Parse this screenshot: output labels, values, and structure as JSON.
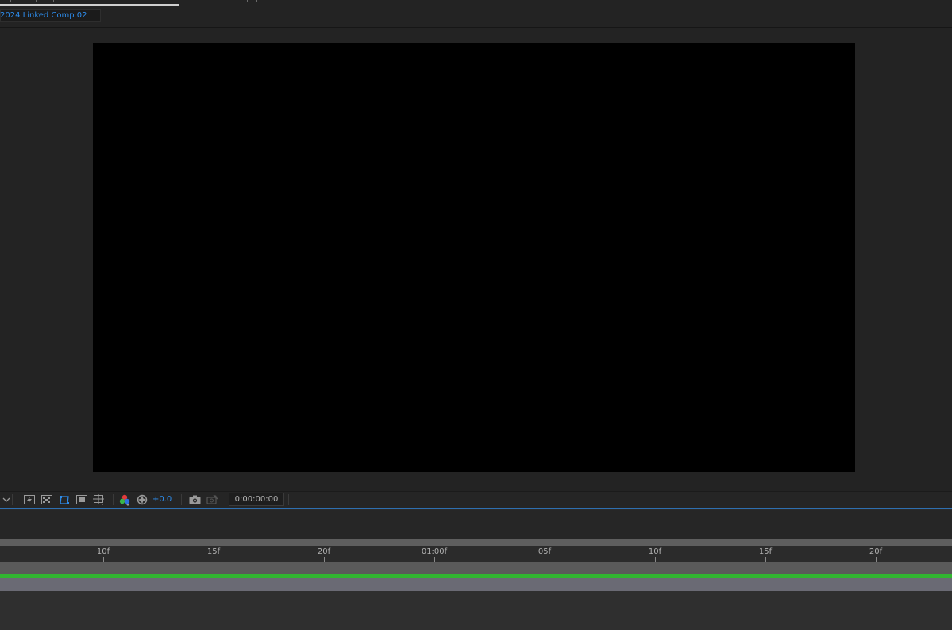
{
  "breadcrumb": {
    "comp_name": "2024 Linked Comp 02"
  },
  "viewer_toolbar": {
    "exposure": "+0.0",
    "timecode": "0:00:00:00"
  },
  "timeline": {
    "ruler_labels": [
      "10f",
      "15f",
      "20f",
      "01:00f",
      "05f",
      "10f",
      "15f",
      "20f"
    ]
  },
  "colors": {
    "accent": "#2d8ceb",
    "layer_green": "#31b531",
    "comp_background": "#000000"
  },
  "icons": {
    "toolbar": [
      "magnification-dropdown-icon",
      "fast-previews-icon",
      "transparency-grid-icon",
      "mask-path-visibility-icon",
      "region-of-interest-icon",
      "grid-guides-icon",
      "show-channel-icon",
      "reset-exposure-icon",
      "snapshot-camera-icon",
      "show-snapshot-icon"
    ]
  }
}
